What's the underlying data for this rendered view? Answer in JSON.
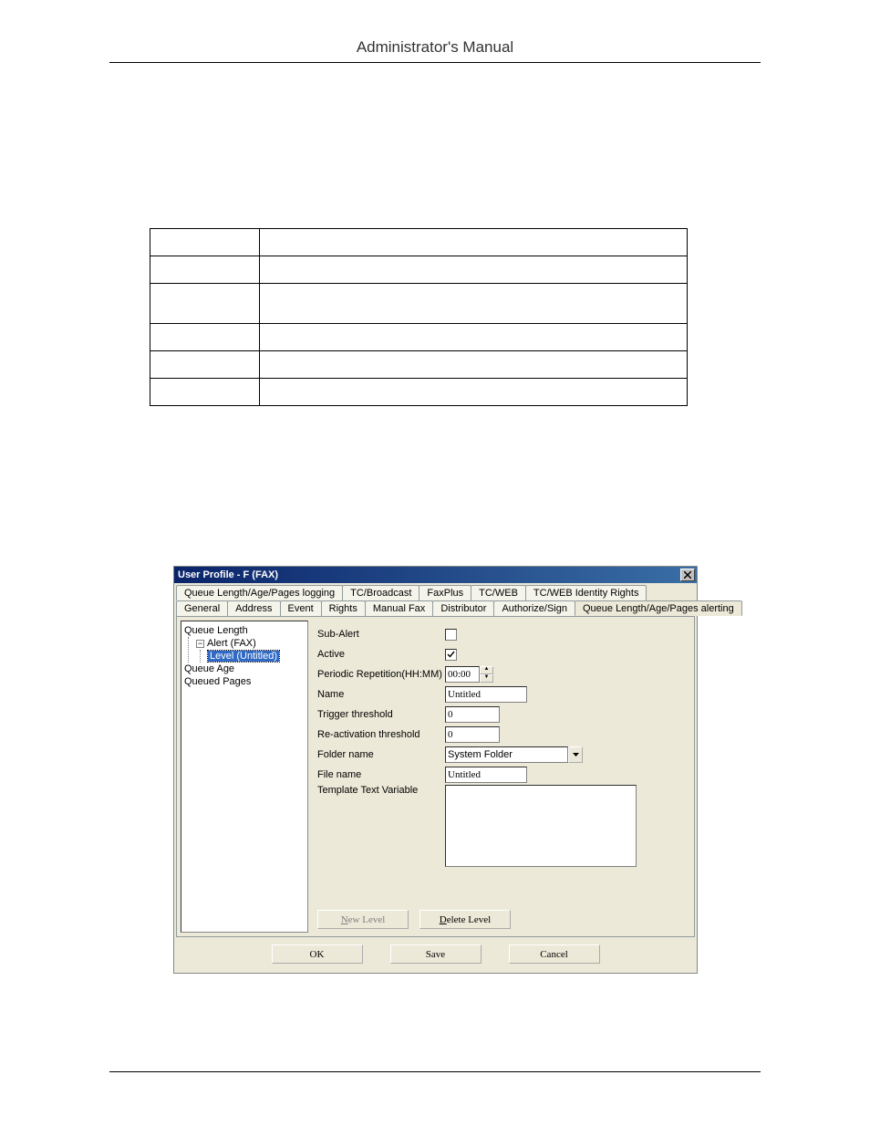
{
  "header": {
    "title": "Administrator's Manual"
  },
  "dialog": {
    "title": "User Profile - F (FAX)",
    "tabs_row1": [
      "Queue Length/Age/Pages logging",
      "TC/Broadcast",
      "FaxPlus",
      "TC/WEB",
      "TC/WEB Identity Rights"
    ],
    "tabs_row2": [
      "General",
      "Address",
      "Event",
      "Rights",
      "Manual Fax",
      "Distributor",
      "Authorize/Sign",
      "Queue Length/Age/Pages alerting"
    ],
    "active_tab": "Queue Length/Age/Pages alerting",
    "tree": {
      "items": [
        "Queue Length",
        "Alert (FAX)",
        "Level (Untitled)",
        "Queue Age",
        "Queued Pages"
      ],
      "selected": "Level (Untitled)"
    },
    "form": {
      "sub_alert_label": "Sub-Alert",
      "sub_alert_checked": false,
      "active_label": "Active",
      "active_checked": true,
      "periodic_label": "Periodic Repetition(HH:MM)",
      "periodic_value": "00:00",
      "name_label": "Name",
      "name_value": "Untitled",
      "trigger_label": "Trigger threshold",
      "trigger_value": "0",
      "reactivation_label": "Re-activation threshold",
      "reactivation_value": "0",
      "folder_label": "Folder name",
      "folder_value": "System Folder",
      "file_label": "File name",
      "file_value": "Untitled",
      "template_label": "Template Text Variable",
      "template_value": "",
      "new_level": "New Level",
      "delete_level": "Delete Level"
    },
    "buttons": {
      "ok": "OK",
      "save": "Save",
      "cancel": "Cancel"
    }
  }
}
